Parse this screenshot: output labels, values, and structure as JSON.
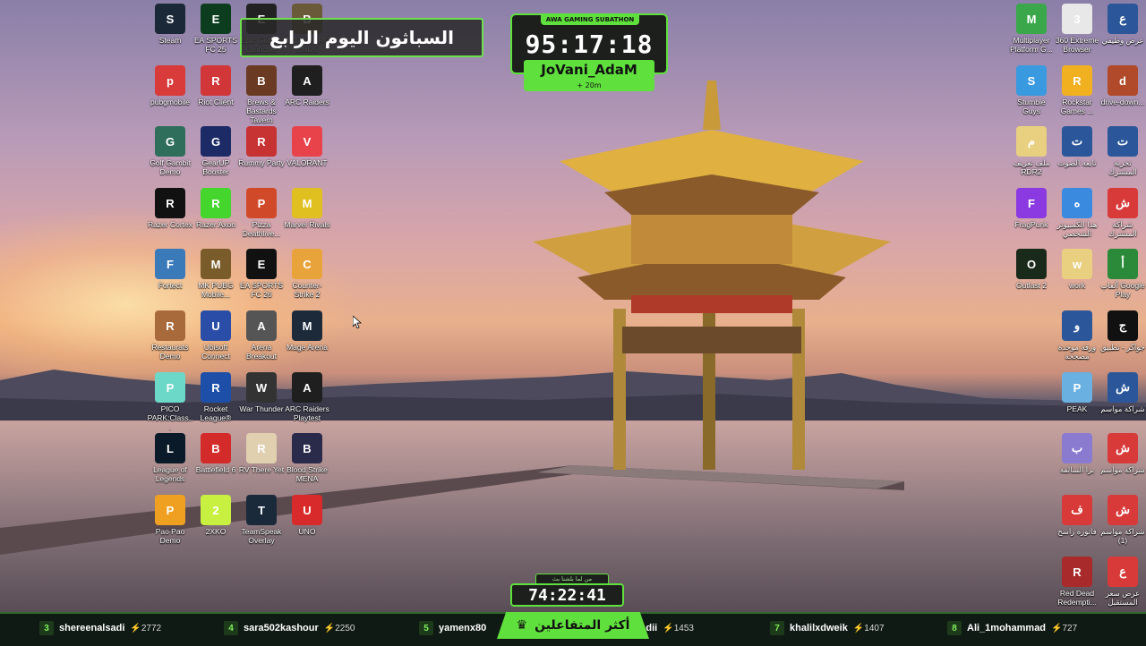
{
  "overlay": {
    "title_banner": "السباثون اليوم الرابع",
    "subathon_tag": "AWA GAMING SUBATHON",
    "subathon_timer": "95:17:18",
    "streamer_name": "JoVani_AdaM",
    "subathon_bonus": "+ 20m",
    "countdown_label": "من لما بلشنا بث",
    "countdown_time": "74:22:41",
    "leaderboard_title": "أكثر المتفاعلين"
  },
  "leaderboard": [
    {
      "rank": "3",
      "name": "shereenalsadi",
      "points": "2772"
    },
    {
      "rank": "4",
      "name": "sara502kashour",
      "points": "2250"
    },
    {
      "rank": "5",
      "name": "yamenx80",
      "points": ""
    },
    {
      "rank": "",
      "name": "alsadii",
      "points": "1453"
    },
    {
      "rank": "7",
      "name": "khalilxdweik",
      "points": "1407"
    },
    {
      "rank": "8",
      "name": "Ali_1mohammad",
      "points": "727"
    }
  ],
  "desktop_left": [
    {
      "label": "Steam",
      "icon": "steam-icon",
      "color": "#1b2838"
    },
    {
      "label": "EA SPORTS FC 25",
      "icon": "fc25-icon",
      "color": "#0b3d1e"
    },
    {
      "label": "Epic Games Launcher",
      "icon": "epic-icon",
      "color": "#222222"
    },
    {
      "label": "BATTLEGROUNDS",
      "icon": "pubg-icon",
      "color": "#6b5a3a"
    },
    {
      "label": "pubgmobile",
      "icon": "pubgmobile-icon",
      "color": "#d93a3a"
    },
    {
      "label": "Riot Client",
      "icon": "riot-icon",
      "color": "#d13639"
    },
    {
      "label": "Brews & Bastards Tavern",
      "icon": "tavern-icon",
      "color": "#6b3a22"
    },
    {
      "label": "ARC Raiders",
      "icon": "arc-icon",
      "color": "#1f1f1f"
    },
    {
      "label": "Golf Gambit Demo",
      "icon": "golf-icon",
      "color": "#2e6e5a"
    },
    {
      "label": "GearUP Booster",
      "icon": "gearup-icon",
      "color": "#1c2a66"
    },
    {
      "label": "Rummy Party",
      "icon": "rummy-icon",
      "color": "#c73232"
    },
    {
      "label": "VALORANT",
      "icon": "valorant-icon",
      "color": "#e8434b"
    },
    {
      "label": "Razer Cortex",
      "icon": "razer-cortex-icon",
      "color": "#111111"
    },
    {
      "label": "Razer Axon",
      "icon": "razer-axon-icon",
      "color": "#44d62c"
    },
    {
      "label": "Pizza Deathlive...",
      "icon": "pizza-icon",
      "color": "#d04a2a"
    },
    {
      "label": "Marvel Rivals",
      "icon": "marvel-icon",
      "color": "#e0c020"
    },
    {
      "label": "Fortect",
      "icon": "fortect-icon",
      "color": "#3a7ab8"
    },
    {
      "label": "MK PUBG Mobile...",
      "icon": "mkpubg-icon",
      "color": "#7a5b2a"
    },
    {
      "label": "EA SPORTS FC 26",
      "icon": "fc26-icon",
      "color": "#111111"
    },
    {
      "label": "Counter-Strike 2",
      "icon": "cs2-icon",
      "color": "#e8a43a"
    },
    {
      "label": "Restaurats Demo",
      "icon": "restaurats-icon",
      "color": "#a86a3a"
    },
    {
      "label": "Ubisoft Connect",
      "icon": "ubisoft-icon",
      "color": "#2a4ea8"
    },
    {
      "label": "Arena Breakout",
      "icon": "arena-icon",
      "color": "#555555"
    },
    {
      "label": "Mage Arena",
      "icon": "mage-icon",
      "color": "#1c2a3a"
    },
    {
      "label": "PICO PARK:Class...",
      "icon": "pico-icon",
      "color": "#6cd8c8"
    },
    {
      "label": "Rocket League®",
      "icon": "rocket-league-icon",
      "color": "#1e4fa8"
    },
    {
      "label": "War Thunder",
      "icon": "war-thunder-icon",
      "color": "#333333"
    },
    {
      "label": "ARC Raiders Playtest",
      "icon": "arc-playtest-icon",
      "color": "#1f1f1f"
    },
    {
      "label": "League of Legends",
      "icon": "lol-icon",
      "color": "#0a1a28"
    },
    {
      "label": "Battlefield 6",
      "icon": "battlefield-icon",
      "color": "#d32a2a"
    },
    {
      "label": "RV There Yet",
      "icon": "rv-icon",
      "color": "#e0d0b0"
    },
    {
      "label": "Blood Strike MENA",
      "icon": "bloodstrike-icon",
      "color": "#2a2a4a"
    },
    {
      "label": "Pao Pao Demo",
      "icon": "paopao-icon",
      "color": "#f0a020"
    },
    {
      "label": "2XKO",
      "icon": "2xko-icon",
      "color": "#c8f040"
    },
    {
      "label": "TeamSpeak Overlay",
      "icon": "teamspeak-icon",
      "color": "#1a2a3a"
    },
    {
      "label": "UNO",
      "icon": "uno-icon",
      "color": "#d82a2a"
    }
  ],
  "desktop_right": [
    {
      "label": "Multiplayer Platform G...",
      "icon": "multiplayer-icon",
      "color": "#3aa84a"
    },
    {
      "label": "360 Extreme Browser",
      "icon": "browser-360-icon",
      "color": "#e8e8e8"
    },
    {
      "label": "عرض وظيفي",
      "icon": "word-doc-icon",
      "color": "#2b579a"
    },
    {
      "label": "Stumble Guys",
      "icon": "stumble-icon",
      "color": "#3a9ae0"
    },
    {
      "label": "Rockstar Games ...",
      "icon": "rockstar-icon",
      "color": "#f0b020"
    },
    {
      "label": "drive-down...",
      "icon": "archive-icon",
      "color": "#b04a2a"
    },
    {
      "label": "ملف تعريف RDR2",
      "icon": "folder-icon",
      "color": "#e8d080"
    },
    {
      "label": "تابعة الصوت",
      "icon": "word-doc-icon",
      "color": "#2b579a"
    },
    {
      "label": "تجربة المشترك",
      "icon": "word-doc-icon",
      "color": "#2b579a"
    },
    {
      "label": "FragPunk",
      "icon": "fragpunk-icon",
      "color": "#8a3ae0"
    },
    {
      "label": "هذا الكمبيوتر الشخصي",
      "icon": "computer-icon",
      "color": "#3a8ae0"
    },
    {
      "label": "شراكة المشترك",
      "icon": "pdf-icon",
      "color": "#d83a3a"
    },
    {
      "label": "Outlast 2",
      "icon": "outlast-icon",
      "color": "#1a2a1a"
    },
    {
      "label": "work",
      "icon": "folder-icon",
      "color": "#e8d080"
    },
    {
      "label": "ألعاب Google Play",
      "icon": "google-play-icon",
      "color": "#2a8a3a"
    },
    {
      "label": "ورقة موحدة مصححة",
      "icon": "word-doc-icon",
      "color": "#2b579a"
    },
    {
      "label": "جواكر - تطبيق",
      "icon": "jawaker-icon",
      "color": "#111111"
    },
    {
      "label": "PEAK",
      "icon": "peak-icon",
      "color": "#6ab0e0"
    },
    {
      "label": "شراكة مواسم",
      "icon": "word-doc-icon",
      "color": "#2b579a"
    },
    {
      "label": "برا السالفة",
      "icon": "bara-icon",
      "color": "#8a7ad0"
    },
    {
      "label": "شراكة مواسم",
      "icon": "pdf-icon",
      "color": "#d83a3a"
    },
    {
      "label": "فاتورة راسخ",
      "icon": "pdf-icon",
      "color": "#d83a3a"
    },
    {
      "label": "شراكة مواسم (1)",
      "icon": "pdf-icon",
      "color": "#d83a3a"
    },
    {
      "label": "Red Dead Redempti...",
      "icon": "rdr-icon",
      "color": "#a82a2a"
    },
    {
      "label": "عرض سعر المستقبل",
      "icon": "pdf-icon",
      "color": "#d83a3a"
    }
  ]
}
